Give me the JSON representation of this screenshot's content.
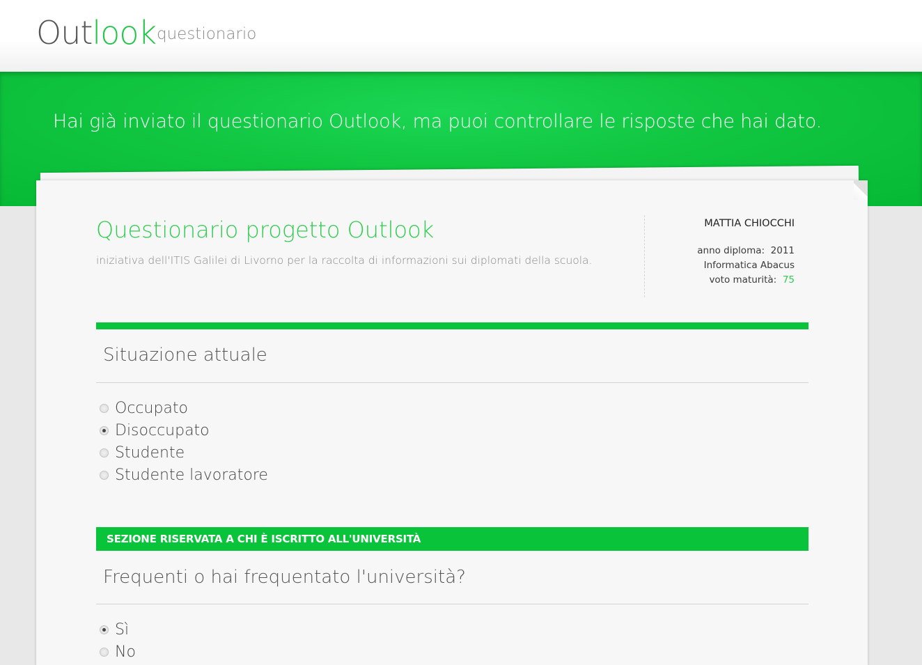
{
  "header": {
    "logo_part1": "Out",
    "logo_part2": "look",
    "subtitle": "questionario"
  },
  "banner": {
    "text": "Hai già inviato il questionario Outlook, ma puoi controllare le risposte che hai dato."
  },
  "questionnaire": {
    "title": "Questionario progetto Outlook",
    "description": "iniziativa dell'ITIS Galilei di Livorno per la raccolta di informazioni sui diplomati della scuola."
  },
  "user": {
    "name": "MATTIA CHIOCCHI",
    "diploma_label": "anno diploma:",
    "diploma_year": "2011",
    "course": "Informatica Abacus",
    "grade_label": "voto maturità:",
    "grade_value": "75"
  },
  "sections": {
    "current_status": {
      "title": "Situazione attuale",
      "options": [
        {
          "label": "Occupato",
          "checked": false
        },
        {
          "label": "Disoccupato",
          "checked": true
        },
        {
          "label": "Studente",
          "checked": false
        },
        {
          "label": "Studente lavoratore",
          "checked": false
        }
      ]
    },
    "university": {
      "bar_label": "SEZIONE RISERVATA A CHI È ISCRITTO ALL'UNIVERSITÀ",
      "question": "Frequenti o hai frequentato l'università?",
      "options": [
        {
          "label": "Sì",
          "checked": true
        },
        {
          "label": "No",
          "checked": false
        }
      ]
    }
  },
  "colors": {
    "accent": "#09c43b",
    "title_green": "#2ecc4f"
  }
}
